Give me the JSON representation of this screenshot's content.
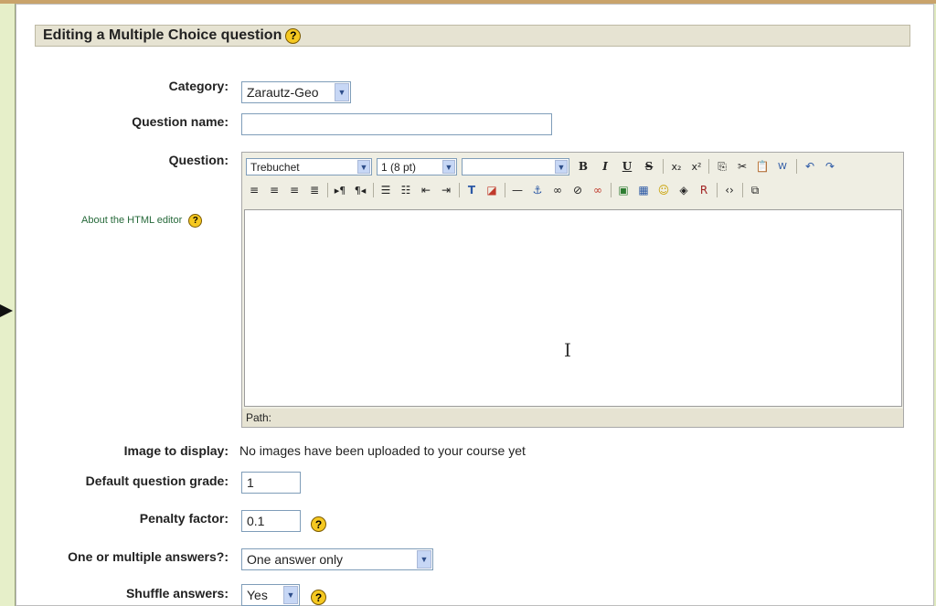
{
  "header": {
    "title": "Editing a Multiple Choice question"
  },
  "form": {
    "category": {
      "label": "Category:",
      "value": "Zarautz-Geo"
    },
    "question_name": {
      "label": "Question name:",
      "value": ""
    },
    "question": {
      "label": "Question:"
    },
    "about_html_editor": "About the HTML editor",
    "editor": {
      "font": "Trebuchet",
      "size": "1 (8 pt)",
      "format": "",
      "path_label": "Path:",
      "toolbar_row1": [
        "bold-icon",
        "italic-icon",
        "underline-icon",
        "strikethrough-icon",
        "subscript-icon",
        "superscript-icon",
        "copy-icon",
        "cut-icon",
        "paste-icon",
        "paste-word-icon",
        "undo-icon",
        "redo-icon"
      ],
      "toolbar_row2": [
        "align-left-icon",
        "align-center-icon",
        "align-right-icon",
        "justify-icon",
        "ltr-icon",
        "rtl-icon",
        "ordered-list-icon",
        "unordered-list-icon",
        "outdent-icon",
        "indent-icon",
        "text-color-icon",
        "background-color-icon",
        "horizontal-rule-icon",
        "anchor-icon",
        "link-icon",
        "unlink-icon",
        "nolink-icon",
        "image-icon",
        "table-icon",
        "smiley-icon",
        "special-char-icon",
        "search-replace-icon",
        "html-source-icon",
        "fullscreen-icon"
      ]
    },
    "image_to_display": {
      "label": "Image to display:",
      "value": "No images have been uploaded to your course yet"
    },
    "default_grade": {
      "label": "Default question grade:",
      "value": "1"
    },
    "penalty_factor": {
      "label": "Penalty factor:",
      "value": "0.1"
    },
    "one_or_multiple": {
      "label": "One or multiple answers?:",
      "value": "One answer only"
    },
    "shuffle": {
      "label": "Shuffle answers:",
      "value": "Yes"
    }
  },
  "colors": {
    "page_bg": "#dfe9bf",
    "header_bg": "#e6e3d2",
    "help_icon": "#f5c821",
    "link": "#26693a"
  }
}
